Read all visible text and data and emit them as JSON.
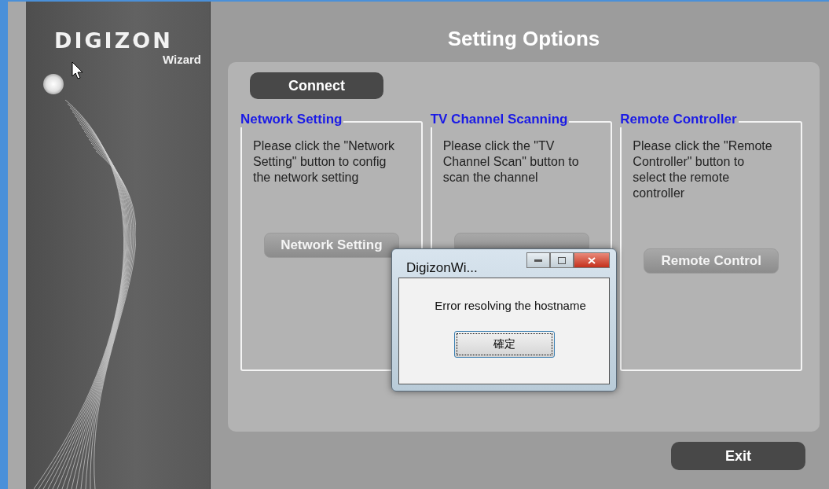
{
  "logo": {
    "brand": "DIGIZON",
    "subtitle": "Wizard"
  },
  "title": "Setting Options",
  "connect_button": "Connect",
  "panels": [
    {
      "heading": "Network Setting",
      "text": "Please click the \"Network Setting\" button to config the network setting",
      "button": "Network Setting"
    },
    {
      "heading": "TV Channel Scanning",
      "text": "Please click the \"TV Channel Scan\" button to scan the channel"
    },
    {
      "heading": "Remote Controller",
      "text": "Please click the \"Remote Controller\" button to select the remote controller",
      "button": "Remote Control"
    }
  ],
  "dialog": {
    "title": "DigizonWi...",
    "message": "Error resolving the hostname",
    "button": "確定"
  },
  "exit_button": "Exit"
}
